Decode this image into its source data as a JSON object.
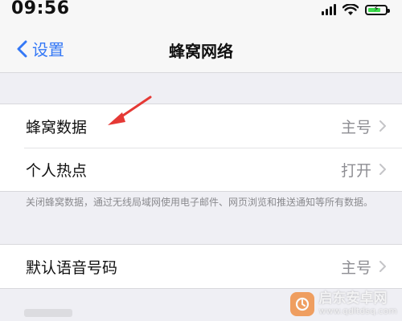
{
  "status_bar": {
    "time": "09:56",
    "battery_level": 0.72,
    "battery_color": "#3ddc4e"
  },
  "nav": {
    "back_label": "设置",
    "title": "蜂窝网络",
    "accent_color": "#3478f6"
  },
  "group1": {
    "rows": [
      {
        "label": "蜂窝数据",
        "value": "主号"
      },
      {
        "label": "个人热点",
        "value": "打开"
      }
    ]
  },
  "footnote": "关闭蜂窝数据，通过无线局域网使用电子邮件、网页浏览和推送通知等所有数据。",
  "group2": {
    "rows": [
      {
        "label": "默认语音号码",
        "value": "主号"
      }
    ]
  },
  "annotation": {
    "arrow_color": "#e53935"
  },
  "watermark": {
    "name": "启东安卓网",
    "url": "www.qdltdsq.com"
  }
}
